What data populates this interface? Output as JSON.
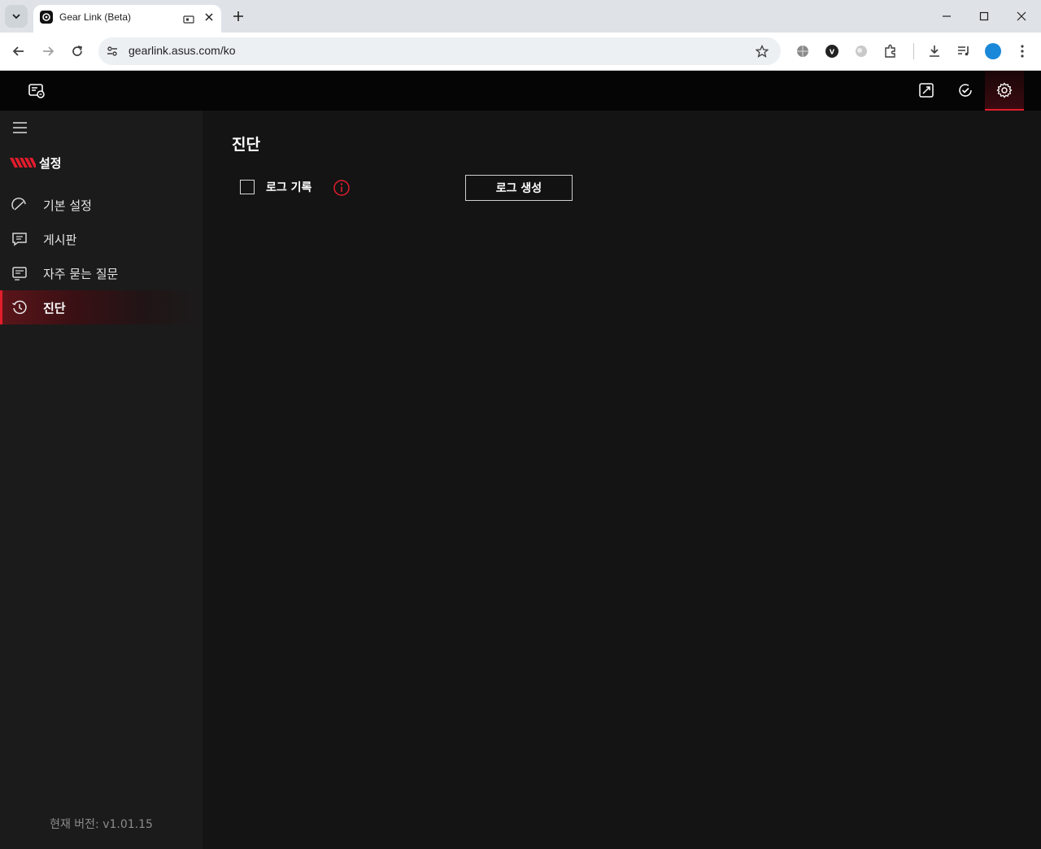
{
  "browser": {
    "tab_title": "Gear Link (Beta)",
    "url": "gearlink.asus.com/ko"
  },
  "sidebar": {
    "section_title": "설정",
    "items": [
      {
        "label": "기본 설정",
        "icon": "gauge-icon"
      },
      {
        "label": "게시판",
        "icon": "message-board-icon"
      },
      {
        "label": "자주 묻는 질문",
        "icon": "faq-icon"
      },
      {
        "label": "진단",
        "icon": "history-icon",
        "active": true
      }
    ],
    "version": "현재 버전: v1.01.15"
  },
  "main": {
    "title": "진단",
    "log_checkbox_label": "로그 기록",
    "log_checkbox_checked": false,
    "generate_log_button": "로그 생성"
  },
  "colors": {
    "accent": "#e21d2c",
    "background": "#141414",
    "sidebar": "#1b1b1b",
    "header": "#050505"
  }
}
